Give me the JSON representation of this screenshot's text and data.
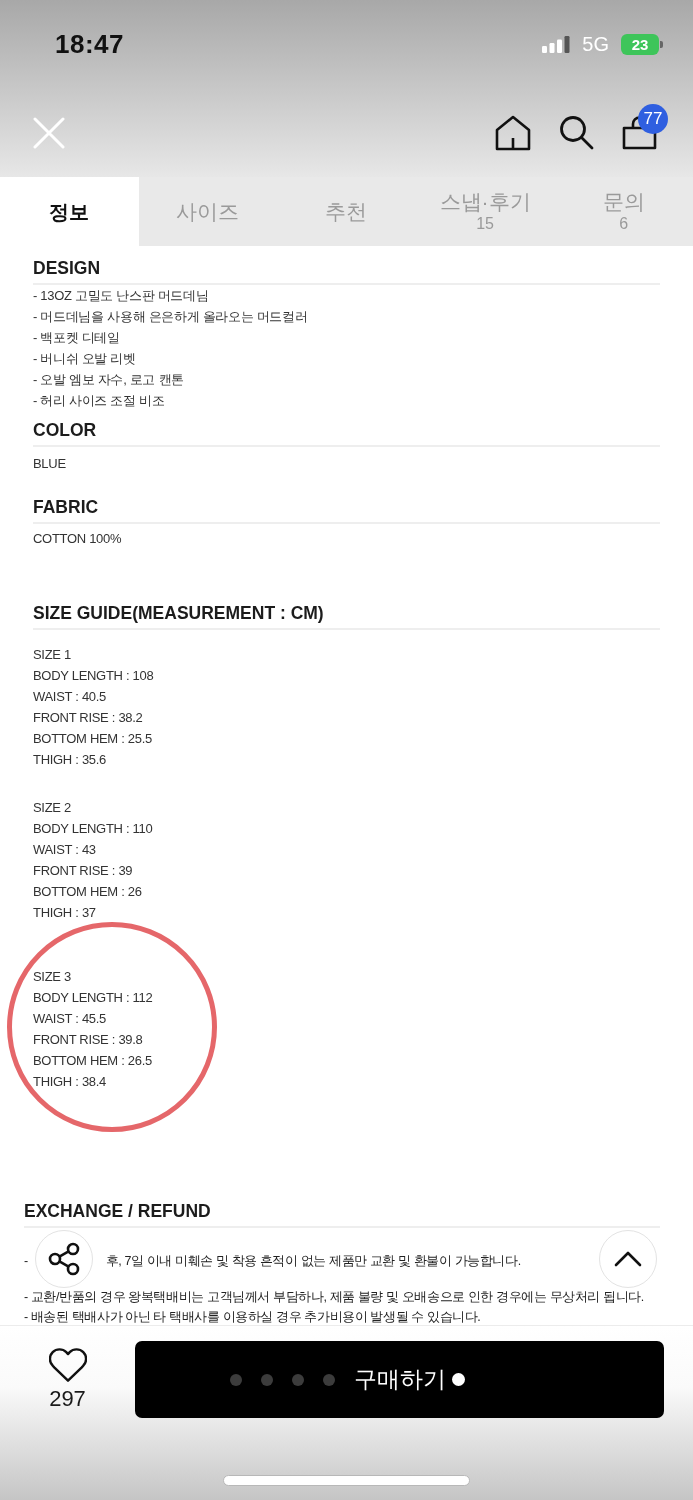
{
  "status_bar": {
    "time": "18:47",
    "network": "5G",
    "battery": "23"
  },
  "nav": {
    "cart_count": "77"
  },
  "tabs": [
    {
      "label": "정보",
      "selected": true
    },
    {
      "label": "사이즈",
      "selected": false
    },
    {
      "label": "추천",
      "selected": false
    },
    {
      "label": "스냅·후기",
      "count": "15",
      "selected": false
    },
    {
      "label": "문의",
      "count": "6",
      "selected": false
    }
  ],
  "design": {
    "heading": "DESIGN",
    "items": [
      "- 13OZ 고밀도 난스판 머드데님",
      "- 머드데님을 사용해 은은하게 올라오는 머드컬러",
      "- 백포켓 디테일",
      "- 버니쉬 오발 리벳",
      "- 오발 엠보 자수, 로고 캔톤",
      "- 허리 사이즈 조절 비조"
    ]
  },
  "color": {
    "heading": "COLOR",
    "value": "BLUE"
  },
  "fabric": {
    "heading": "FABRIC",
    "value": "COTTON 100%"
  },
  "size_guide": {
    "heading": "SIZE GUIDE(MEASUREMENT : CM)",
    "sizes": [
      {
        "label": "SIZE 1",
        "lines": [
          "BODY LENGTH : 108",
          "WAIST : 40.5",
          "FRONT RISE : 38.2",
          "BOTTOM HEM : 25.5",
          "THIGH : 35.6"
        ],
        "highlighted": false
      },
      {
        "label": "SIZE 2",
        "lines": [
          "BODY LENGTH : 110",
          "WAIST : 43",
          "FRONT RISE : 39",
          "BOTTOM HEM : 26",
          "THIGH : 37"
        ],
        "highlighted": false
      },
      {
        "label": "SIZE 3",
        "lines": [
          "BODY LENGTH : 112",
          "WAIST : 45.5",
          "FRONT RISE : 39.8",
          "BOTTOM HEM : 26.5",
          "THIGH : 38.4"
        ],
        "highlighted": true
      }
    ]
  },
  "exchange": {
    "heading": "EXCHANGE / REFUND",
    "lines": [
      {
        "parts": [
          "-",
          "후, 7일 이내 미훼손 및 착용 흔적이 없는 제품만 교환 및 환불이 가능합니다."
        ]
      },
      {
        "parts": [
          "- 교환/반품의 경우 왕복택배비는 고객님께서 부담하나, 제품 불량 및 오배송으로 인한 경우에는 무상처리 됩니다."
        ]
      },
      {
        "parts": [
          "- 배송된 택배사가 아닌 타 택배사를 이용하실 경우 추가비용이 발생될 수 있습니다."
        ]
      }
    ]
  },
  "like": {
    "count": "297",
    "liked": false
  },
  "buy_button": {
    "label": "구매하기",
    "dots_before": [
      {
        "selected": false
      },
      {
        "selected": false
      },
      {
        "selected": false
      },
      {
        "selected": false
      }
    ],
    "dots_after": [
      {
        "selected": true
      }
    ]
  }
}
